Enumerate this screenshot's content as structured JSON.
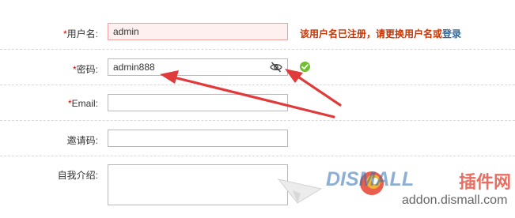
{
  "form": {
    "required_mark": "*",
    "username": {
      "label": "用户名:",
      "value": "admin",
      "error_text": "该用户名已注册，请更换用户名或",
      "error_link": "登录"
    },
    "password": {
      "label": "密码:",
      "value": "admin888",
      "toggle_icon": "eye-slash-icon",
      "status_icon": "check-circle-icon"
    },
    "email": {
      "label": "Email:",
      "value": ""
    },
    "invite": {
      "label": "邀请码:",
      "value": ""
    },
    "bio": {
      "label": "自我介绍:",
      "value": ""
    }
  },
  "annotation": {
    "arrow_color": "#e03a3a"
  },
  "watermark": {
    "logo_text": "DISMALL",
    "title_text": "插件网",
    "url_text": "addon.dismall.com"
  }
}
